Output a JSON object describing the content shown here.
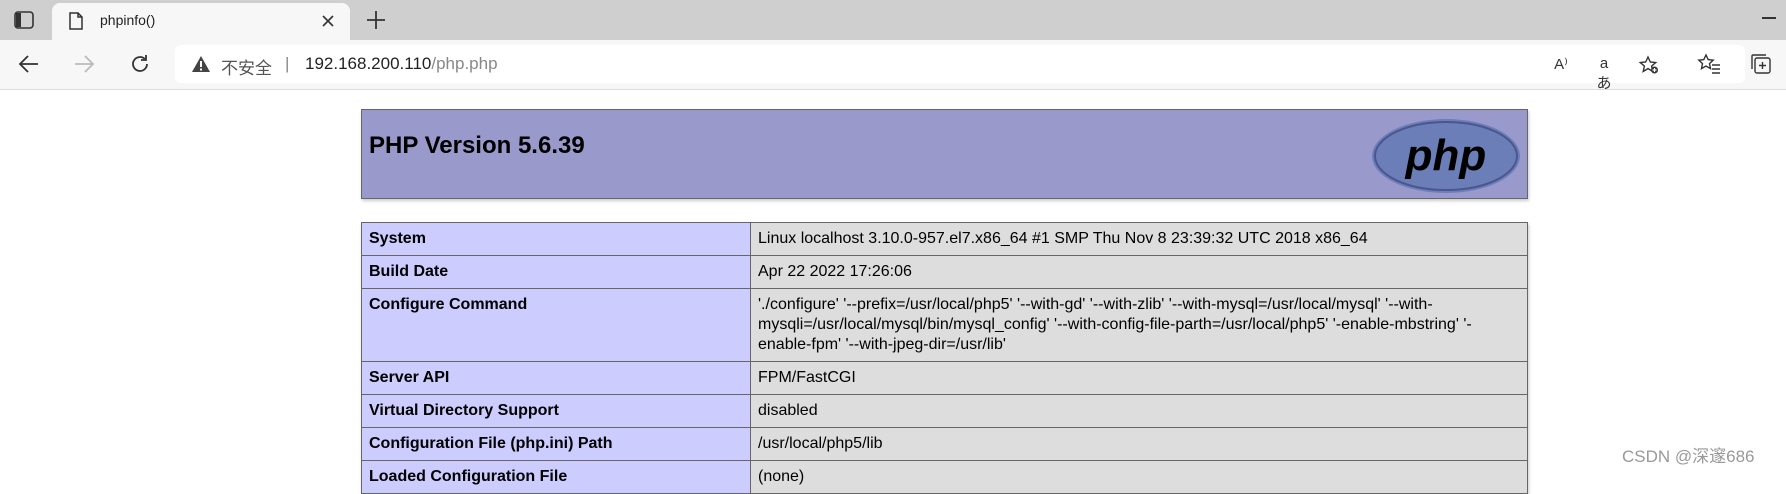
{
  "browser": {
    "tab": {
      "title": "phpinfo()"
    },
    "address": {
      "security_label": "不安全",
      "separator": "|",
      "host": "192.168.200.110",
      "path": "/php.php"
    },
    "icons": {
      "tab_actions": "tab-actions-icon",
      "favicon": "page-icon",
      "close": "close-icon",
      "new_tab": "plus-icon",
      "minimize": "minimize-icon",
      "back": "back-arrow-icon",
      "forward": "forward-arrow-icon",
      "reload": "reload-icon",
      "warning": "warning-icon",
      "read_aloud": "read-aloud-icon",
      "translate": "translate-icon",
      "add_favorite": "add-favorite-icon",
      "favorites": "favorites-icon",
      "collections": "collections-icon"
    },
    "read_aloud_glyph": "A⁾",
    "translate_glyph": "aあ"
  },
  "page": {
    "php_version_title": "PHP Version 5.6.39",
    "logo_text": "php",
    "rows": [
      {
        "key": "System",
        "value": "Linux localhost 3.10.0-957.el7.x86_64 #1 SMP Thu Nov 8 23:39:32 UTC 2018 x86_64"
      },
      {
        "key": "Build Date",
        "value": "Apr 22 2022 17:26:06"
      },
      {
        "key": "Configure Command",
        "value": "'./configure' '--prefix=/usr/local/php5' '--with-gd' '--with-zlib' '--with-mysql=/usr/local/mysql' '--with-mysqli=/usr/local/mysql/bin/mysql_config' '--with-config-file-parth=/usr/local/php5' '-enable-mbstring' '-enable-fpm' '--with-jpeg-dir=/usr/lib'"
      },
      {
        "key": "Server API",
        "value": "FPM/FastCGI"
      },
      {
        "key": "Virtual Directory Support",
        "value": "disabled"
      },
      {
        "key": "Configuration File (php.ini) Path",
        "value": "/usr/local/php5/lib"
      },
      {
        "key": "Loaded Configuration File",
        "value": "(none)"
      }
    ]
  },
  "watermark": "CSDN @深邃686",
  "colors": {
    "header_bg": "#9999cc",
    "key_bg": "#ccccff",
    "value_bg": "#dddddd"
  }
}
